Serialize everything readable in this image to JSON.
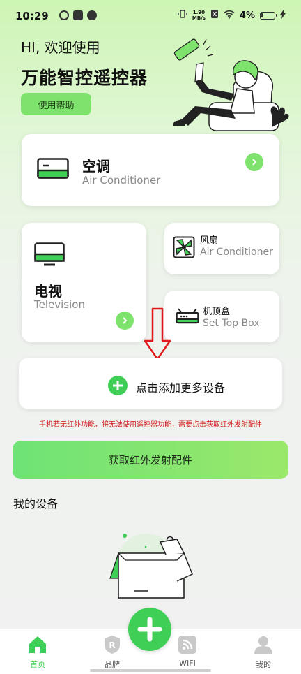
{
  "status_bar": {
    "time": "10:29",
    "net_speed_value": "1.90",
    "net_speed_unit": "MB/s",
    "battery": "4%"
  },
  "header": {
    "greeting": "HI, 欢迎使用",
    "app_title": "万能智控遥控器",
    "help_button": "使用帮助"
  },
  "devices": {
    "ac": {
      "title": "空调",
      "subtitle": "Air Conditioner"
    },
    "tv": {
      "title": "电视",
      "subtitle": "Television"
    },
    "fan": {
      "title": "风扇",
      "subtitle": "Air Conditioner"
    },
    "stb": {
      "title": "机顶盒",
      "subtitle": "Set Top Box"
    }
  },
  "add_more": {
    "label": "点击添加更多设备"
  },
  "warning_text": "手机若无红外功能，将无法使用遥控器功能，需要点击获取红外发射配件",
  "get_accessory_button": "获取红外发射配件",
  "my_devices_title": "我的设备",
  "tabs": [
    {
      "label": "首页",
      "icon": "home-icon",
      "active": true
    },
    {
      "label": "品牌",
      "icon": "brand-icon",
      "active": false
    },
    {
      "label": "WIFI",
      "icon": "wifi-icon",
      "active": false
    },
    {
      "label": "我的",
      "icon": "profile-icon",
      "active": false
    }
  ],
  "colors": {
    "accent": "#7ee36c",
    "fab": "#3fcf56",
    "warning": "#d11b1b",
    "tab_active": "#3fcf56"
  }
}
